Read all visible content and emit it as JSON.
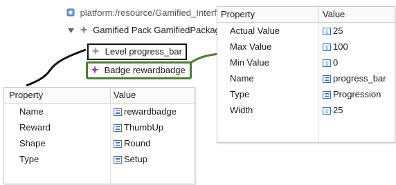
{
  "tree": {
    "root_label": "platform:/resource/Gamified_Interfaces/",
    "pack_label": "Gamified Pack GamifiedPackage",
    "level_label": "Level progress_bar",
    "badge_label": "Badge rewardbadge"
  },
  "colors": {
    "connector_black": "#111111",
    "connector_green": "#4e7a36",
    "badge_icon": "#8e44ad",
    "prop_icon": "#3b6fb6"
  },
  "badge_panel": {
    "header_property": "Property",
    "header_value": "Value",
    "rows": [
      {
        "key": "Name",
        "value": "rewardbadge",
        "icon": "text-prop-icon"
      },
      {
        "key": "Reward",
        "value": "ThumbUp",
        "icon": "list-prop-icon"
      },
      {
        "key": "Shape",
        "value": "Round",
        "icon": "list-prop-icon"
      },
      {
        "key": "Type",
        "value": "Setup",
        "icon": "list-prop-icon"
      }
    ]
  },
  "level_panel": {
    "header_property": "Property",
    "header_value": "Value",
    "rows": [
      {
        "key": "Actual Value",
        "value": "25",
        "icon": "number-prop-icon"
      },
      {
        "key": "Max Value",
        "value": "100",
        "icon": "number-prop-icon"
      },
      {
        "key": "Min Value",
        "value": "0",
        "icon": "number-prop-icon"
      },
      {
        "key": "Name",
        "value": "progress_bar",
        "icon": "text-prop-icon"
      },
      {
        "key": "Type",
        "value": "Progression",
        "icon": "list-prop-icon"
      },
      {
        "key": "Width",
        "value": "25",
        "icon": "number-prop-icon"
      }
    ]
  }
}
